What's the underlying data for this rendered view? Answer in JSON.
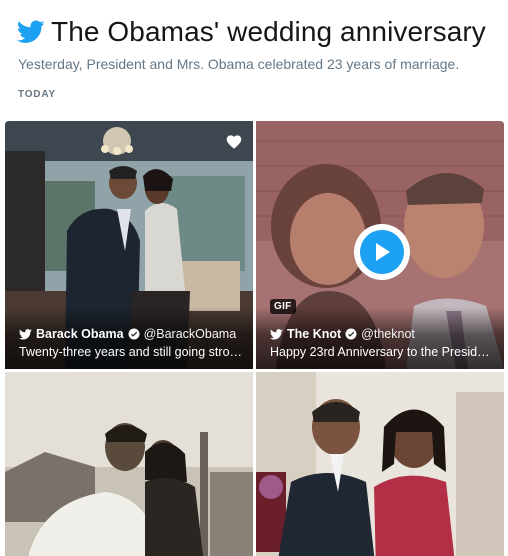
{
  "header": {
    "title": "The Obamas' wedding anniversary",
    "subtitle": "Yesterday, President and Mrs. Obama celebrated 23 years of marriage.",
    "section_label": "TODAY",
    "brand_icon": "twitter-bird-icon",
    "brand_color": "#1da1f2"
  },
  "tiles": [
    {
      "name": "Barack Obama",
      "handle": "@BarackObama",
      "text": "Twenty-three years and still going stro…",
      "icon": "heart-icon"
    },
    {
      "name": "The Knot",
      "handle": "@theknot",
      "text": "Happy 23rd Anniversary to the Preside…",
      "badge": "GIF",
      "icon": "play-icon"
    },
    {},
    {}
  ]
}
